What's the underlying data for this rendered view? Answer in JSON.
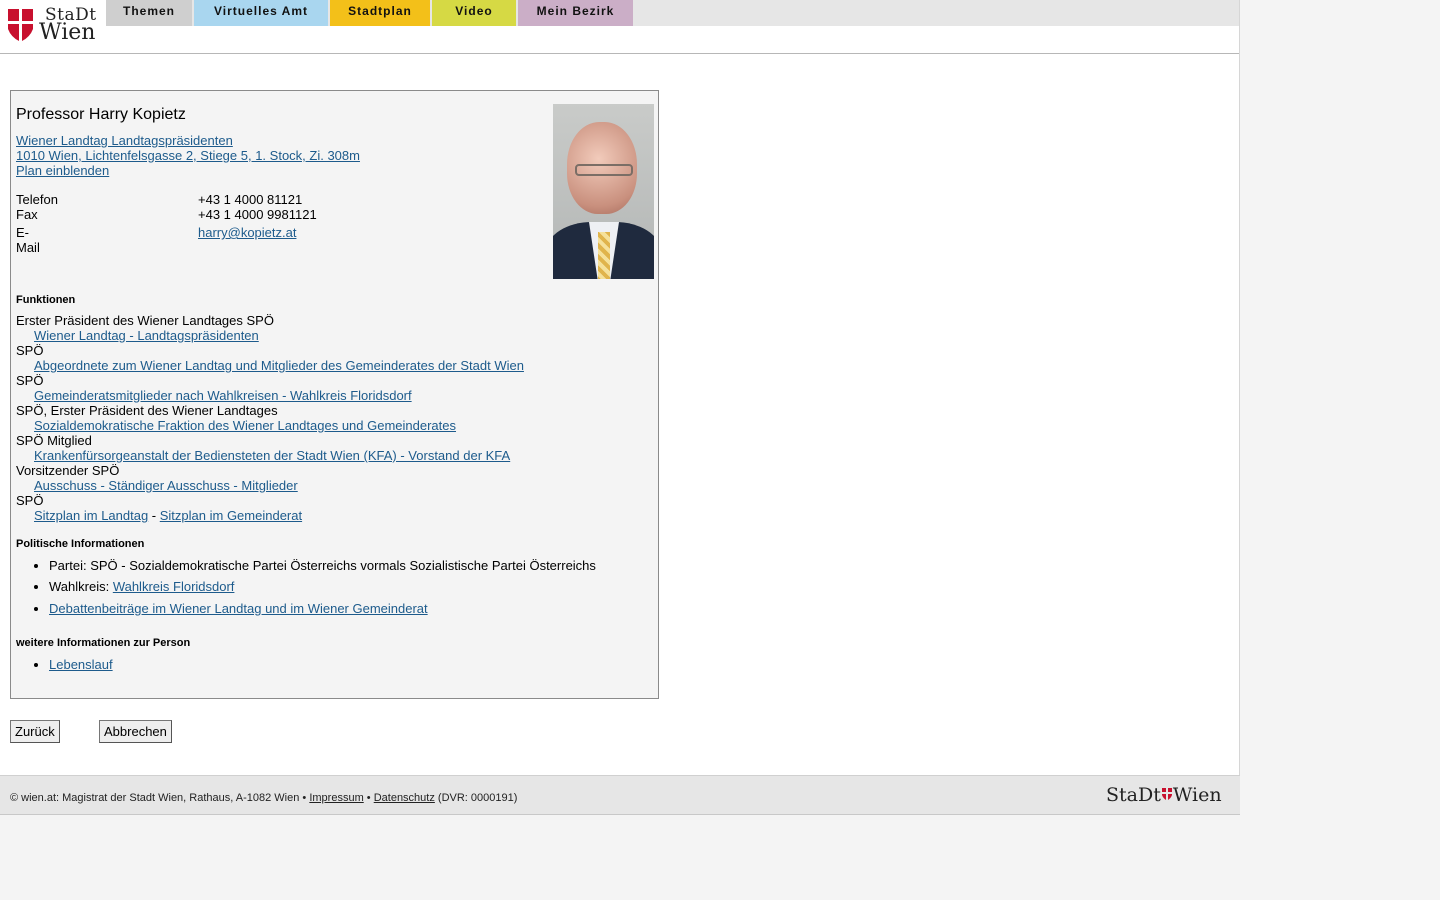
{
  "header": {
    "logo": {
      "top": "StaDt",
      "bottom": "Wien"
    },
    "tabs": [
      {
        "label": "Themen",
        "color": "#cfcfcf"
      },
      {
        "label": "Virtuelles Amt",
        "color": "#a9d6ef"
      },
      {
        "label": "Stadtplan",
        "color": "#f3c019"
      },
      {
        "label": "Video",
        "color": "#d6d944"
      },
      {
        "label": "Mein Bezirk",
        "color": "#cbaec7"
      }
    ]
  },
  "person": {
    "name": "Professor Harry Kopietz",
    "institution_link": "Wiener Landtag Landtagspräsidenten",
    "address_link": "1010 Wien, Lichtenfelsgasse 2, Stiege 5, 1. Stock, Zi. 308m",
    "map_link": "Plan einblenden",
    "contacts": [
      {
        "label": "Telefon",
        "value": "+43 1 4000 81121",
        "link": false
      },
      {
        "label": "Fax",
        "value": "+43 1 4000 9981121",
        "link": false
      },
      {
        "label": "E-Mail",
        "value": "harry@kopietz.at",
        "link": true
      }
    ]
  },
  "functions": {
    "title": "Funktionen",
    "items": [
      {
        "role": "Erster Präsident des Wiener Landtages SPÖ",
        "link": "Wiener Landtag - Landtagspräsidenten"
      },
      {
        "role": "SPÖ",
        "link": "Abgeordnete zum Wiener Landtag und Mitglieder des Gemeinderates der Stadt Wien"
      },
      {
        "role": "SPÖ",
        "link": "Gemeinderatsmitglieder nach Wahlkreisen - Wahlkreis Floridsdorf"
      },
      {
        "role": "SPÖ, Erster Präsident des Wiener Landtages",
        "link": "Sozialdemokratische Fraktion des Wiener Landtages und Gemeinderates"
      },
      {
        "role": "SPÖ Mitglied",
        "link": "Krankenfürsorgeanstalt der Bediensteten der Stadt Wien (KFA) - Vorstand der KFA"
      },
      {
        "role": "Vorsitzender SPÖ",
        "link": "Ausschuss - Ständiger Ausschuss - Mitglieder"
      },
      {
        "role": "SPÖ"
      }
    ],
    "seat_link_1": "Sitzplan im Landtag",
    "seat_separator": " - ",
    "seat_link_2": "Sitzplan im Gemeinderat"
  },
  "political": {
    "title": "Politische Informationen",
    "party_prefix": "Partei: ",
    "party": "SPÖ - Sozialdemokratische Partei Österreichs vormals Sozialistische Partei Österreichs",
    "district_prefix": "Wahlkreis: ",
    "district_link": "Wahlkreis Floridsdorf",
    "debates_link": "Debattenbeiträge im Wiener Landtag und im Wiener Gemeinderat"
  },
  "more": {
    "title": "weitere Informationen zur Person",
    "cv_link": "Lebenslauf"
  },
  "buttons": {
    "back": "Zurück",
    "cancel": "Abbrechen"
  },
  "footer": {
    "prefix": "© wien.at: Magistrat der Stadt Wien, Rathaus, A-1082 Wien • ",
    "impressum": "Impressum",
    "sep": " • ",
    "datenschutz": "Datenschutz",
    "dvr": " (DVR: 0000191)",
    "logo_left": "StaDt",
    "logo_right": "Wien"
  },
  "colors": {
    "link": "#1d5b8c",
    "city_red": "#c8102e"
  }
}
